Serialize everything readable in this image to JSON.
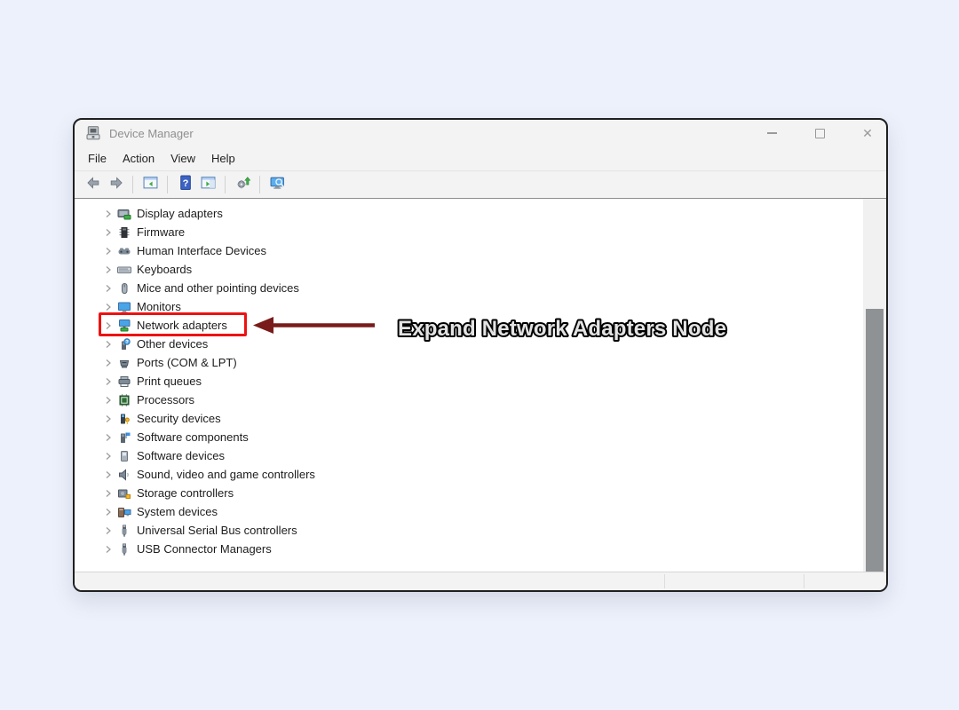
{
  "window": {
    "title": "Device Manager"
  },
  "menu": {
    "items": [
      "File",
      "Action",
      "View",
      "Help"
    ]
  },
  "toolbar": {
    "groups": [
      [
        {
          "icon": "back-icon"
        },
        {
          "icon": "forward-icon"
        }
      ],
      [
        {
          "icon": "show-console-tree-icon"
        }
      ],
      [
        {
          "icon": "help-icon"
        },
        {
          "icon": "show-action-pane-icon"
        }
      ],
      [
        {
          "icon": "scan-hardware-changes-icon"
        }
      ],
      [
        {
          "icon": "computer-search-icon"
        }
      ]
    ]
  },
  "tree": {
    "items": [
      {
        "label": "Display adapters",
        "icon": "display-adapters",
        "highlighted": false
      },
      {
        "label": "Firmware",
        "icon": "firmware",
        "highlighted": false
      },
      {
        "label": "Human Interface Devices",
        "icon": "hid",
        "highlighted": false
      },
      {
        "label": "Keyboards",
        "icon": "keyboard",
        "highlighted": false
      },
      {
        "label": "Mice and other pointing devices",
        "icon": "mouse",
        "highlighted": false
      },
      {
        "label": "Monitors",
        "icon": "monitor",
        "highlighted": false
      },
      {
        "label": "Network adapters",
        "icon": "network",
        "highlighted": true
      },
      {
        "label": "Other devices",
        "icon": "other",
        "highlighted": false
      },
      {
        "label": "Ports (COM & LPT)",
        "icon": "ports",
        "highlighted": false
      },
      {
        "label": "Print queues",
        "icon": "printer",
        "highlighted": false
      },
      {
        "label": "Processors",
        "icon": "processor",
        "highlighted": false
      },
      {
        "label": "Security devices",
        "icon": "security",
        "highlighted": false
      },
      {
        "label": "Software components",
        "icon": "software-component",
        "highlighted": false
      },
      {
        "label": "Software devices",
        "icon": "software-device",
        "highlighted": false
      },
      {
        "label": "Sound, video and game controllers",
        "icon": "sound",
        "highlighted": false
      },
      {
        "label": "Storage controllers",
        "icon": "storage",
        "highlighted": false
      },
      {
        "label": "System devices",
        "icon": "system",
        "highlighted": false
      },
      {
        "label": "Universal Serial Bus controllers",
        "icon": "usb",
        "highlighted": false
      },
      {
        "label": "USB Connector Managers",
        "icon": "usb",
        "highlighted": false
      }
    ]
  },
  "annotation": {
    "text": "Expand Network Adapters Node",
    "arrow_color": "#7a1b1b",
    "box_color": "#ee1111",
    "text_fill": "#e3e3e3",
    "text_outline": "#000000"
  }
}
